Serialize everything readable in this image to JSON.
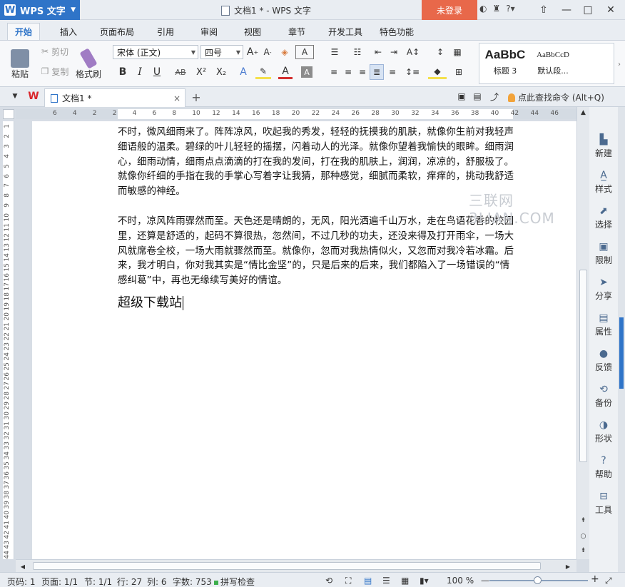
{
  "titlebar": {
    "app_name": "WPS 文字",
    "window_title": "文档1 * - WPS 文字",
    "login": "未登录",
    "minimize": "—",
    "maximize": "□",
    "close": "✕"
  },
  "tabs": [
    "开始",
    "插入",
    "页面布局",
    "引用",
    "审阅",
    "视图",
    "章节",
    "开发工具",
    "特色功能"
  ],
  "ribbon": {
    "paste": "粘贴",
    "cut": "剪切",
    "copy": "复制",
    "format_painter": "格式刷",
    "font_name": "宋体 (正文)",
    "font_size": "四号",
    "bold": "B",
    "italic": "I",
    "underline": "U",
    "strikethrough": "AB",
    "superscript": "X²",
    "subscript": "X₂",
    "style1_preview": "AaBbC",
    "style1_name": "标题 3",
    "style2_preview": "AaBbCcD",
    "style2_name": "默认段..."
  },
  "doc_tab": {
    "name": "文档1 *",
    "close": "×",
    "add": "+",
    "find_command": "点此查找命令 (Alt+Q)"
  },
  "ruler": {
    "h_ticks": [
      "6",
      "4",
      "2",
      "2",
      "4",
      "6",
      "8",
      "10",
      "12",
      "14",
      "16",
      "18",
      "20",
      "22",
      "24",
      "26",
      "28",
      "30",
      "32",
      "34",
      "36",
      "38",
      "40",
      "42",
      "44",
      "46"
    ],
    "v_ticks": [
      "1",
      "2",
      "3",
      "4",
      "5",
      "6",
      "7",
      "8",
      "9",
      "10",
      "11",
      "12",
      "13",
      "14",
      "15",
      "16",
      "17",
      "18",
      "19",
      "20",
      "21",
      "22",
      "23",
      "24",
      "25",
      "26",
      "27",
      "28",
      "29",
      "30",
      "31",
      "32",
      "33",
      "34",
      "35",
      "36",
      "37",
      "38",
      "39",
      "40",
      "41",
      "42",
      "43",
      "44"
    ]
  },
  "document": {
    "para1": "不时，微风细雨来了。阵阵凉风，吹起我的秀发，轻轻的抚摸我的肌肤，就像你生前对我轻声细语般的温柔。碧绿的叶儿轻轻的摇摆，闪着动人的光泽。就像你望着我愉快的眼眸。细雨润心，细雨动情，细雨点点滴滴的打在我的发间，打在我的肌肤上，润润，凉凉的，舒服极了。就像你纤细的手指在我的手掌心写着字让我猜，那种感觉，细腻而柔软，痒痒的，挑动我舒适而敏感的神经。",
    "para2": "不时，凉风阵雨骤然而至。天色还是晴朗的，无风，阳光洒遍千山万水，走在鸟语花香的校园里，还算是舒适的，起码不算很热，忽然间，不过几秒的功夫，还没来得及打开雨伞，一场大风就席卷全校，一场大雨就骤然而至。就像你，忽而对我热情似火，又忽而对我冷若冰霜。后来，我才明白，你对我其实是“情比金坚”的，只是后来的后来，我们都陷入了一场错误的“情感纠葛”中，再也无缘续写美好的情谊。",
    "line3": "超级下载站",
    "watermark": "三联网 3LIAN.COM"
  },
  "sidebar": [
    "新建",
    "样式",
    "选择",
    "限制",
    "分享",
    "属性",
    "反馈",
    "备份",
    "形状",
    "帮助",
    "工具"
  ],
  "status": {
    "page_code": "页码: 1",
    "pages": "页面: 1/1",
    "section": "节: 1/1",
    "row": "行: 27",
    "col": "列: 6",
    "words": "字数: 753",
    "spellcheck": "拼写检查",
    "zoom": "100 %",
    "zoom_minus": "—",
    "zoom_plus": "+"
  },
  "colors": {
    "accent": "#2f74c8",
    "login": "#e8684a"
  }
}
